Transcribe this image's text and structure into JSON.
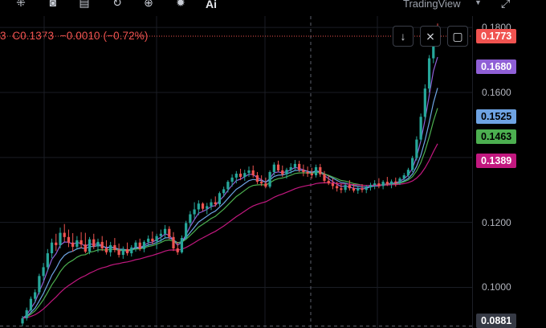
{
  "toolbar": {
    "icons": [
      "indicators-icon",
      "camera-icon",
      "layout-icon",
      "replay-icon",
      "add-icon",
      "settings-icon"
    ],
    "ai_label": "Ai",
    "brand": "TradingView"
  },
  "legend": {
    "open_partial": "3",
    "close_label": "C",
    "close_value": "0.1373",
    "change": "−0.0010",
    "change_pct": "(−0.72%)"
  },
  "price_axis": {
    "ticks": [
      "0.1800",
      "0.1600",
      "0.1200",
      "0.1000"
    ],
    "tags": [
      {
        "label": "0.1773",
        "bg": "#f05350",
        "fg": "#ffffff"
      },
      {
        "label": "0.1680",
        "bg": "#8f5fd6",
        "fg": "#ffffff"
      },
      {
        "label": "0.1525",
        "bg": "#6ea3e3",
        "fg": "#000000"
      },
      {
        "label": "0.1463",
        "bg": "#4caf50",
        "fg": "#000000"
      },
      {
        "label": "0.1389",
        "bg": "#c2187f",
        "fg": "#ffffff"
      },
      {
        "label": "0.0881",
        "bg": "#363a45",
        "fg": "#ffffff"
      }
    ]
  },
  "colors": {
    "up": "#26a69a",
    "down": "#ef5350",
    "ma_fast": "#8f5fd6",
    "ma_mid": "#6ea3e3",
    "ma_slow": "#4caf50",
    "ma_long": "#c2187f",
    "grid": "#1a1d24"
  },
  "chart_data": {
    "type": "candlestick",
    "ylim": [
      0.0875,
      0.1835
    ],
    "candles": [
      [
        0.0889,
        0.0912,
        0.0881,
        0.0905
      ],
      [
        0.0905,
        0.0938,
        0.0898,
        0.093
      ],
      [
        0.093,
        0.0972,
        0.0925,
        0.0965
      ],
      [
        0.0965,
        0.0994,
        0.0952,
        0.0985
      ],
      [
        0.0985,
        0.1042,
        0.0978,
        0.1035
      ],
      [
        0.1035,
        0.1075,
        0.1021,
        0.1062
      ],
      [
        0.1062,
        0.1118,
        0.105,
        0.1105
      ],
      [
        0.1105,
        0.115,
        0.109,
        0.1138
      ],
      [
        0.1138,
        0.1165,
        0.1112,
        0.113
      ],
      [
        0.113,
        0.1184,
        0.112,
        0.1168
      ],
      [
        0.1168,
        0.1195,
        0.1141,
        0.1155
      ],
      [
        0.1155,
        0.1178,
        0.1124,
        0.1138
      ],
      [
        0.1138,
        0.1167,
        0.111,
        0.1125
      ],
      [
        0.1125,
        0.1158,
        0.1116,
        0.1145
      ],
      [
        0.1145,
        0.117,
        0.112,
        0.1132
      ],
      [
        0.1132,
        0.1168,
        0.1105,
        0.111
      ],
      [
        0.111,
        0.1155,
        0.1102,
        0.1148
      ],
      [
        0.1148,
        0.1165,
        0.1118,
        0.1126
      ],
      [
        0.1126,
        0.115,
        0.1108,
        0.114
      ],
      [
        0.114,
        0.1158,
        0.1112,
        0.112
      ],
      [
        0.112,
        0.1145,
        0.1101,
        0.1108
      ],
      [
        0.1108,
        0.114,
        0.1095,
        0.113
      ],
      [
        0.113,
        0.1152,
        0.1108,
        0.1115
      ],
      [
        0.1115,
        0.1135,
        0.1092,
        0.11
      ],
      [
        0.11,
        0.1126,
        0.1088,
        0.1118
      ],
      [
        0.1118,
        0.1138,
        0.1098,
        0.1105
      ],
      [
        0.1105,
        0.113,
        0.1095,
        0.1123
      ],
      [
        0.1123,
        0.1145,
        0.111,
        0.1138
      ],
      [
        0.1138,
        0.115,
        0.1112,
        0.1118
      ],
      [
        0.1118,
        0.1145,
        0.1108,
        0.114
      ],
      [
        0.114,
        0.116,
        0.1125,
        0.115
      ],
      [
        0.115,
        0.1172,
        0.1132,
        0.1142
      ],
      [
        0.1142,
        0.1165,
        0.1118,
        0.1158
      ],
      [
        0.1158,
        0.1178,
        0.114,
        0.1165
      ],
      [
        0.1165,
        0.1192,
        0.115,
        0.118
      ],
      [
        0.118,
        0.1188,
        0.1148,
        0.1155
      ],
      [
        0.1155,
        0.117,
        0.1112,
        0.112
      ],
      [
        0.112,
        0.114,
        0.11,
        0.1108
      ],
      [
        0.1108,
        0.116,
        0.1104,
        0.1152
      ],
      [
        0.1152,
        0.1205,
        0.1148,
        0.1198
      ],
      [
        0.1198,
        0.1235,
        0.1188,
        0.1225
      ],
      [
        0.1225,
        0.1262,
        0.1212,
        0.124
      ],
      [
        0.124,
        0.1268,
        0.1222,
        0.1258
      ],
      [
        0.1258,
        0.1262,
        0.1235,
        0.1242
      ],
      [
        0.1242,
        0.126,
        0.1225,
        0.125
      ],
      [
        0.125,
        0.1272,
        0.1238,
        0.1262
      ],
      [
        0.1262,
        0.128,
        0.1248,
        0.1256
      ],
      [
        0.1256,
        0.1295,
        0.125,
        0.129
      ],
      [
        0.129,
        0.131,
        0.1278,
        0.1302
      ],
      [
        0.1302,
        0.133,
        0.1292,
        0.1325
      ],
      [
        0.1325,
        0.1348,
        0.131,
        0.1338
      ],
      [
        0.1338,
        0.1358,
        0.132,
        0.135
      ],
      [
        0.135,
        0.1365,
        0.133,
        0.134
      ],
      [
        0.134,
        0.1362,
        0.1328,
        0.1352
      ],
      [
        0.1352,
        0.1372,
        0.134,
        0.136
      ],
      [
        0.136,
        0.1375,
        0.1338,
        0.1345
      ],
      [
        0.1345,
        0.1355,
        0.1318,
        0.1325
      ],
      [
        0.1325,
        0.1345,
        0.1312,
        0.132
      ],
      [
        0.132,
        0.1338,
        0.1305,
        0.131
      ],
      [
        0.131,
        0.136,
        0.1305,
        0.1355
      ],
      [
        0.1355,
        0.1385,
        0.1345,
        0.1378
      ],
      [
        0.1378,
        0.139,
        0.1355,
        0.136
      ],
      [
        0.136,
        0.1375,
        0.134,
        0.1348
      ],
      [
        0.1348,
        0.1368,
        0.1335,
        0.1362
      ],
      [
        0.1362,
        0.1382,
        0.135,
        0.137
      ],
      [
        0.137,
        0.1392,
        0.1358,
        0.138
      ],
      [
        0.138,
        0.139,
        0.1355,
        0.1362
      ],
      [
        0.1362,
        0.1378,
        0.1342,
        0.1355
      ],
      [
        0.1355,
        0.1372,
        0.134,
        0.135
      ],
      [
        0.135,
        0.1368,
        0.1335,
        0.1345
      ],
      [
        0.1345,
        0.1378,
        0.1338,
        0.137
      ],
      [
        0.137,
        0.138,
        0.134,
        0.1348
      ],
      [
        0.1348,
        0.1358,
        0.132,
        0.1328
      ],
      [
        0.1328,
        0.1345,
        0.1315,
        0.132
      ],
      [
        0.132,
        0.1335,
        0.1302,
        0.1312
      ],
      [
        0.1312,
        0.1325,
        0.1295,
        0.1305
      ],
      [
        0.1305,
        0.1318,
        0.129,
        0.13
      ],
      [
        0.13,
        0.1322,
        0.1292,
        0.1315
      ],
      [
        0.1315,
        0.133,
        0.1298,
        0.1305
      ],
      [
        0.1305,
        0.1318,
        0.1292,
        0.1298
      ],
      [
        0.1298,
        0.1312,
        0.1288,
        0.1305
      ],
      [
        0.1305,
        0.1318,
        0.1292,
        0.13
      ],
      [
        0.13,
        0.1315,
        0.129,
        0.1308
      ],
      [
        0.1308,
        0.1322,
        0.1298,
        0.1315
      ],
      [
        0.1315,
        0.133,
        0.1302,
        0.132
      ],
      [
        0.132,
        0.1336,
        0.1305,
        0.1312
      ],
      [
        0.1312,
        0.133,
        0.1302,
        0.1325
      ],
      [
        0.1325,
        0.134,
        0.1312,
        0.1318
      ],
      [
        0.1318,
        0.1332,
        0.1305,
        0.1326
      ],
      [
        0.1326,
        0.1338,
        0.131,
        0.1322
      ],
      [
        0.1322,
        0.134,
        0.1315,
        0.1335
      ],
      [
        0.1335,
        0.1352,
        0.1325,
        0.1345
      ],
      [
        0.1345,
        0.1368,
        0.134,
        0.1362
      ],
      [
        0.1362,
        0.1405,
        0.1355,
        0.1398
      ],
      [
        0.1398,
        0.1465,
        0.139,
        0.1455
      ],
      [
        0.1455,
        0.1535,
        0.1448,
        0.1525
      ],
      [
        0.1525,
        0.1625,
        0.1515,
        0.1612
      ],
      [
        0.1612,
        0.1715,
        0.16,
        0.1705
      ],
      [
        0.1705,
        0.179,
        0.169,
        0.1778
      ],
      [
        0.1778,
        0.1812,
        0.1755,
        0.1773
      ]
    ],
    "moving_averages": [
      {
        "color_key": "ma_fast",
        "last": 0.168
      },
      {
        "color_key": "ma_mid",
        "last": 0.1525
      },
      {
        "color_key": "ma_slow",
        "last": 0.1463
      },
      {
        "color_key": "ma_long",
        "last": 0.1389
      }
    ],
    "y_ticks": [
      0.18,
      0.16,
      0.12,
      0.1
    ]
  }
}
